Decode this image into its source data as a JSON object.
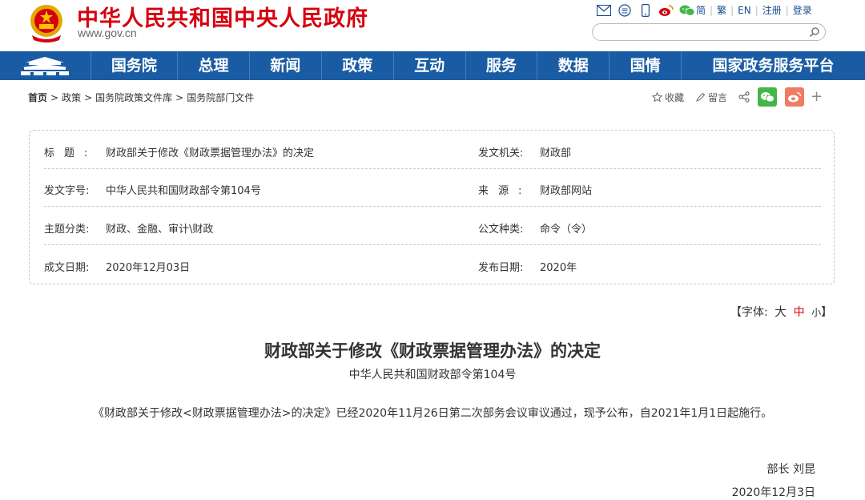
{
  "header": {
    "site_title": "中华人民共和国中央人民政府",
    "site_domain": "www.gov.cn",
    "links": [
      "简",
      "繁",
      "EN",
      "注册",
      "登录"
    ],
    "search_placeholder": ""
  },
  "nav": {
    "items": [
      "国务院",
      "总理",
      "新闻",
      "政策",
      "互动",
      "服务",
      "数据",
      "国情",
      "国家政务服务平台"
    ]
  },
  "breadcrumb": {
    "items": [
      "首页",
      "政策",
      "国务院政策文件库",
      "国务院部门文件"
    ],
    "separator": ">"
  },
  "tools": {
    "favorite": "收藏",
    "comment": "留言",
    "plus": "+"
  },
  "info": {
    "title_label": "标题:",
    "title_value": "财政部关于修改《财政票据管理办法》的决定",
    "issuer_label": "发文机关:",
    "issuer_value": "财政部",
    "doc_no_label": "发文字号:",
    "doc_no_value": "中华人民共和国财政部令第104号",
    "source_label": "来源:",
    "source_value": "财政部网站",
    "topic_label": "主题分类:",
    "topic_value": "财政、金融、审计\\财政",
    "type_label": "公文种类:",
    "type_value": "命令（令）",
    "date_label": "成文日期:",
    "date_value": "2020年12月03日",
    "publish_label": "发布日期:",
    "publish_value": "2020年"
  },
  "fontsize": {
    "label": "【字体:",
    "large": "大",
    "medium": "中",
    "small": "小",
    "close": "】"
  },
  "article": {
    "title": "财政部关于修改《财政票据管理办法》的决定",
    "subtitle": "中华人民共和国财政部令第104号",
    "body": "《财政部关于修改<财政票据管理办法>的决定》已经2020年11月26日第二次部务会议审议通过，现予公布，自2021年1月1日起施行。",
    "signature": "部长 刘昆",
    "date": "2020年12月3日"
  },
  "colors": {
    "brand_red": "#d6000f",
    "nav_blue": "#1a5ca4",
    "link_blue": "#164d8f",
    "wechat_green": "#44b549",
    "weibo_orange": "#ef7c62"
  }
}
